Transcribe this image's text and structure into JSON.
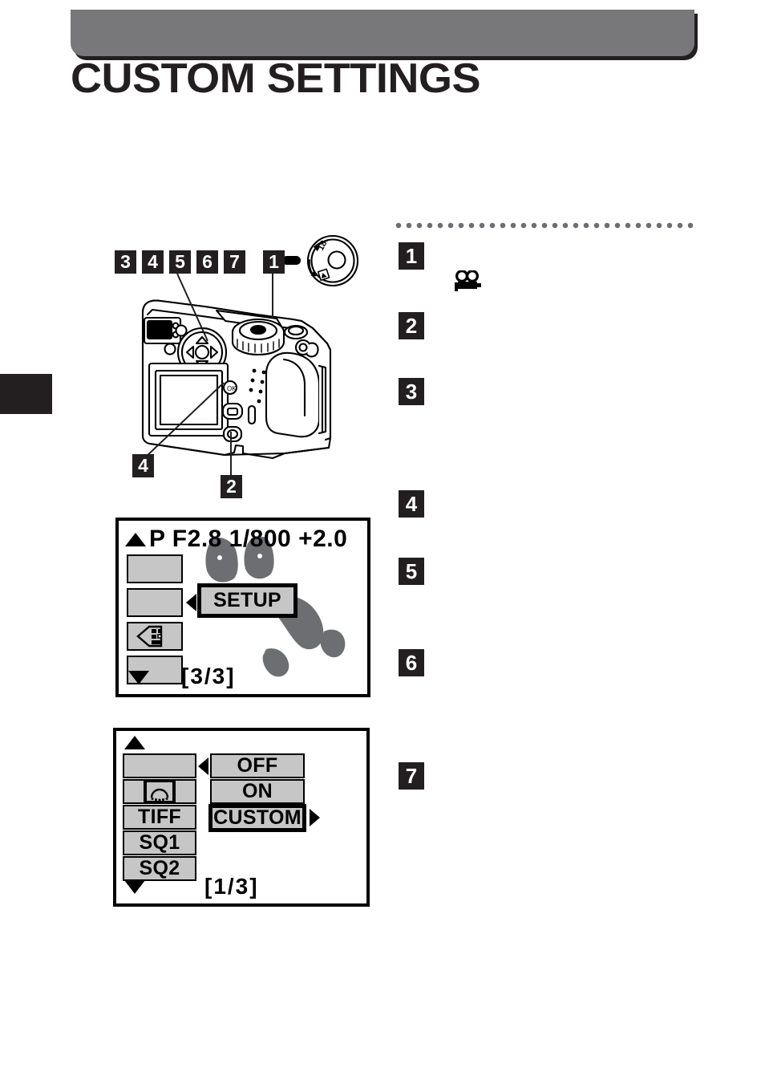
{
  "header": {
    "title": "CUSTOM SETTINGS",
    "bar_color": "#78777a",
    "title_color": "#231f20"
  },
  "chapter_tab": {
    "color": "#231f20"
  },
  "camera_callouts": {
    "top_row": [
      "3",
      "4",
      "5",
      "6",
      "7"
    ],
    "shutter": "1",
    "ok_button": "4",
    "menu_button": "2"
  },
  "steps": {
    "rule_color": "#6d6e71",
    "items": [
      {
        "number": "1",
        "icon": "movie-camera-icon"
      },
      {
        "number": "2",
        "icon": null
      },
      {
        "number": "3",
        "icon": null
      },
      {
        "number": "4",
        "icon": null
      },
      {
        "number": "5",
        "icon": null
      },
      {
        "number": "6",
        "icon": null
      },
      {
        "number": "7",
        "icon": null
      }
    ]
  },
  "lcd_top": {
    "status_line": "P  F2.8   1/800  +2.0",
    "scroll_up": "▲",
    "scroll_down": "▼",
    "left_items": [
      {
        "label": "",
        "icon": null
      },
      {
        "label": "",
        "icon": null
      },
      {
        "label": "",
        "icon": "setup-card-icon"
      },
      {
        "label": "",
        "icon": null
      }
    ],
    "selected_option": "SETUP",
    "page_indicator": "[3/3]"
  },
  "lcd_bottom": {
    "scroll_up": "▲",
    "scroll_down": "▼",
    "left_items": [
      {
        "label": "",
        "icon": null
      },
      {
        "label": "",
        "icon": "hq-quality-icon"
      },
      {
        "label": "TIFF",
        "icon": null
      },
      {
        "label": "SQ1",
        "icon": null
      },
      {
        "label": "SQ2",
        "icon": null
      }
    ],
    "right_options": [
      {
        "label": "OFF",
        "selected": false
      },
      {
        "label": "ON",
        "selected": false
      },
      {
        "label": "CUSTOM",
        "selected": true
      }
    ],
    "page_indicator": "[1/3]"
  },
  "colors": {
    "ink": "#231f20",
    "lcd_cell": "#c6c6c6",
    "dog_gray": "#6d6e71"
  }
}
